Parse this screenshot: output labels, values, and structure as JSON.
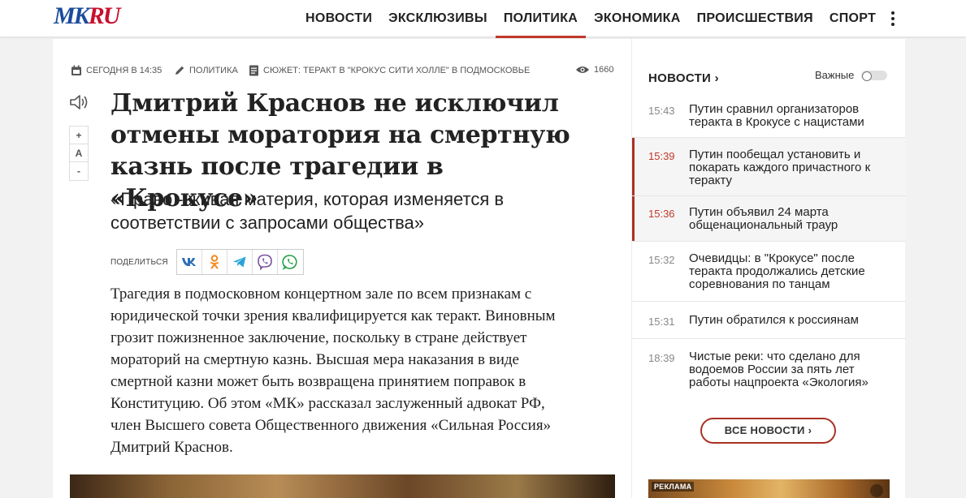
{
  "site": {
    "logo_part1": "MK",
    "logo_part2": "RU"
  },
  "nav": [
    {
      "label": "НОВОСТИ",
      "active": false
    },
    {
      "label": "ЭКСКЛЮЗИВЫ",
      "active": false
    },
    {
      "label": "ПОЛИТИКА",
      "active": true
    },
    {
      "label": "ЭКОНОМИКА",
      "active": false
    },
    {
      "label": "ПРОИСШЕСТВИЯ",
      "active": false
    },
    {
      "label": "СПОРТ",
      "active": false
    }
  ],
  "article": {
    "date": "СЕГОДНЯ В 14:35",
    "rubric": "ПОЛИТИКА",
    "story": "СЮЖЕТ: ТЕРАКТ В \"КРОКУС СИТИ ХОЛЛЕ\" В ПОДМОСКОВЬЕ",
    "views": "1660",
    "title": "Дмитрий Краснов не исключил отмены моратория на смертную казнь после трагедии в «Крокусе»",
    "subtitle": "«Право - живая материя, которая изменяется в соответствии с запросами общества»",
    "share_label": "ПОДЕЛИТЬСЯ",
    "lead": "Трагедия в подмосковном концертном зале по всем признакам с юридической точки зрения квалифицируется как теракт. Виновным грозит пожизненное заключение, поскольку в стране действует мораторий на смертную казнь. Высшая мера наказания в виде смертной казни может быть возвращена принятием поправок в Конституцию. Об этом «МК» рассказал заслуженный адвокат РФ, член Высшего совета Общественного движения «Сильная Россия» Дмитрий Краснов.",
    "font_controls": {
      "plus": "+",
      "reset": "A",
      "minus": "-"
    }
  },
  "sidebar": {
    "heading": "НОВОСТИ ›",
    "important_label": "Важные",
    "news": [
      {
        "time": "15:43",
        "text": "Путин сравнил организаторов теракта в Крокусе с нацистами",
        "highlight": false
      },
      {
        "time": "15:39",
        "text": "Путин пообещал установить и покарать каждого причастного к теракту",
        "highlight": true
      },
      {
        "time": "15:36",
        "text": "Путин объявил 24 марта общенациональный траур",
        "highlight": true
      },
      {
        "time": "15:32",
        "text": "Очевидцы: в \"Крокусе\" после теракта продолжались детские соревнования по танцам",
        "highlight": false
      },
      {
        "time": "15:31",
        "text": "Путин обратился к россиянам",
        "highlight": false
      },
      {
        "time": "18:39",
        "text": "Чистые реки: что сделано для водоемов России за пять лет работы нацпроекта «Экология»",
        "highlight": false
      }
    ],
    "all_news": "ВСЕ НОВОСТИ ›",
    "ad_label": "РЕКЛАМА"
  },
  "colors": {
    "accent": "#c0392b",
    "logo_blue": "#1a4b9c",
    "logo_red": "#c8102e"
  }
}
